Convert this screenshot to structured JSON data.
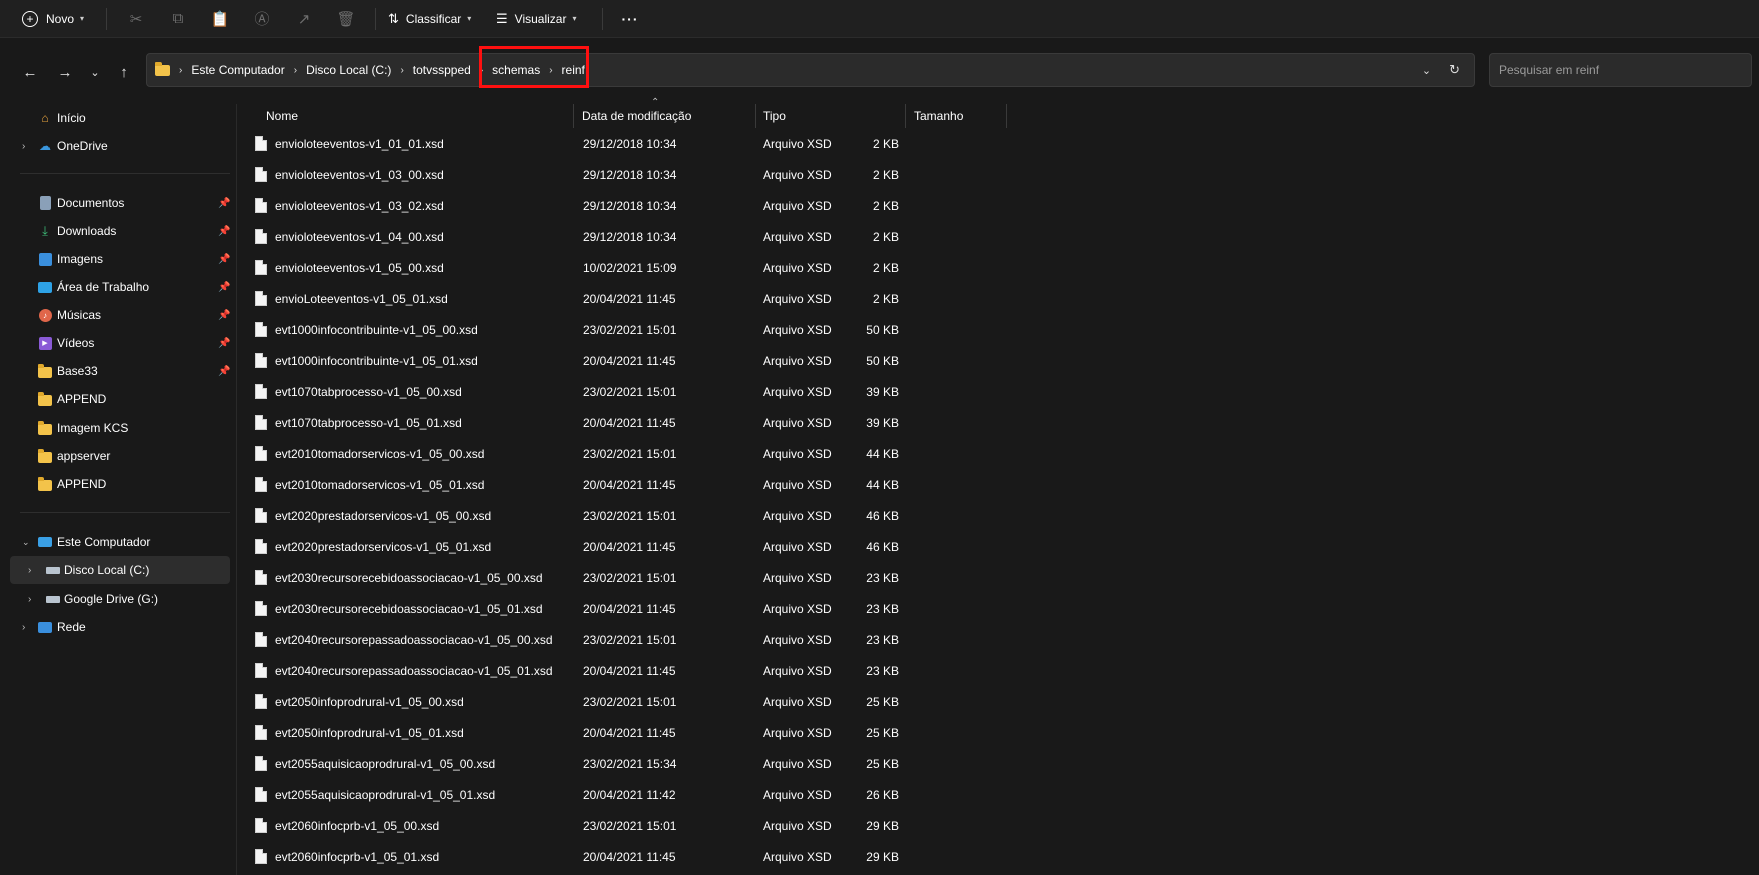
{
  "toolbar": {
    "new_label": "Novo",
    "sort_label": "Classificar",
    "view_label": "Visualizar",
    "more_label": "···"
  },
  "address": {
    "crumbs": [
      "Este Computador",
      "Disco Local (C:)",
      "totvsspped",
      "schemas",
      "reinf"
    ]
  },
  "search": {
    "placeholder": "Pesquisar em reinf"
  },
  "sidebar": {
    "top": [
      {
        "label": "Início"
      },
      {
        "label": "OneDrive"
      }
    ],
    "quick": [
      {
        "label": "Documentos"
      },
      {
        "label": "Downloads"
      },
      {
        "label": "Imagens"
      },
      {
        "label": "Área de Trabalho"
      },
      {
        "label": "Músicas"
      },
      {
        "label": "Vídeos"
      },
      {
        "label": "Base33"
      },
      {
        "label": "APPEND"
      },
      {
        "label": "Imagem KCS"
      },
      {
        "label": "appserver"
      },
      {
        "label": "APPEND"
      }
    ],
    "computer": [
      {
        "label": "Este Computador"
      },
      {
        "label": "Disco Local (C:)"
      },
      {
        "label": "Google Drive (G:)"
      },
      {
        "label": "Rede"
      }
    ]
  },
  "columns": {
    "name": "Nome",
    "modified": "Data de modificação",
    "type": "Tipo",
    "size": "Tamanho"
  },
  "files": [
    {
      "name": "envioloteeventos-v1_01_01.xsd",
      "modified": "29/12/2018 10:34",
      "type": "Arquivo XSD",
      "size": "2 KB"
    },
    {
      "name": "envioloteeventos-v1_03_00.xsd",
      "modified": "29/12/2018 10:34",
      "type": "Arquivo XSD",
      "size": "2 KB"
    },
    {
      "name": "envioloteeventos-v1_03_02.xsd",
      "modified": "29/12/2018 10:34",
      "type": "Arquivo XSD",
      "size": "2 KB"
    },
    {
      "name": "envioloteeventos-v1_04_00.xsd",
      "modified": "29/12/2018 10:34",
      "type": "Arquivo XSD",
      "size": "2 KB"
    },
    {
      "name": "envioloteeventos-v1_05_00.xsd",
      "modified": "10/02/2021 15:09",
      "type": "Arquivo XSD",
      "size": "2 KB"
    },
    {
      "name": "envioLoteeventos-v1_05_01.xsd",
      "modified": "20/04/2021 11:45",
      "type": "Arquivo XSD",
      "size": "2 KB"
    },
    {
      "name": "evt1000infocontribuinte-v1_05_00.xsd",
      "modified": "23/02/2021 15:01",
      "type": "Arquivo XSD",
      "size": "50 KB"
    },
    {
      "name": "evt1000infocontribuinte-v1_05_01.xsd",
      "modified": "20/04/2021 11:45",
      "type": "Arquivo XSD",
      "size": "50 KB"
    },
    {
      "name": "evt1070tabprocesso-v1_05_00.xsd",
      "modified": "23/02/2021 15:01",
      "type": "Arquivo XSD",
      "size": "39 KB"
    },
    {
      "name": "evt1070tabprocesso-v1_05_01.xsd",
      "modified": "20/04/2021 11:45",
      "type": "Arquivo XSD",
      "size": "39 KB"
    },
    {
      "name": "evt2010tomadorservicos-v1_05_00.xsd",
      "modified": "23/02/2021 15:01",
      "type": "Arquivo XSD",
      "size": "44 KB"
    },
    {
      "name": "evt2010tomadorservicos-v1_05_01.xsd",
      "modified": "20/04/2021 11:45",
      "type": "Arquivo XSD",
      "size": "44 KB"
    },
    {
      "name": "evt2020prestadorservicos-v1_05_00.xsd",
      "modified": "23/02/2021 15:01",
      "type": "Arquivo XSD",
      "size": "46 KB"
    },
    {
      "name": "evt2020prestadorservicos-v1_05_01.xsd",
      "modified": "20/04/2021 11:45",
      "type": "Arquivo XSD",
      "size": "46 KB"
    },
    {
      "name": "evt2030recursorecebidoassociacao-v1_05_00.xsd",
      "modified": "23/02/2021 15:01",
      "type": "Arquivo XSD",
      "size": "23 KB"
    },
    {
      "name": "evt2030recursorecebidoassociacao-v1_05_01.xsd",
      "modified": "20/04/2021 11:45",
      "type": "Arquivo XSD",
      "size": "23 KB"
    },
    {
      "name": "evt2040recursorepassadoassociacao-v1_05_00.xsd",
      "modified": "23/02/2021 15:01",
      "type": "Arquivo XSD",
      "size": "23 KB"
    },
    {
      "name": "evt2040recursorepassadoassociacao-v1_05_01.xsd",
      "modified": "20/04/2021 11:45",
      "type": "Arquivo XSD",
      "size": "23 KB"
    },
    {
      "name": "evt2050infoprodrural-v1_05_00.xsd",
      "modified": "23/02/2021 15:01",
      "type": "Arquivo XSD",
      "size": "25 KB"
    },
    {
      "name": "evt2050infoprodrural-v1_05_01.xsd",
      "modified": "20/04/2021 11:45",
      "type": "Arquivo XSD",
      "size": "25 KB"
    },
    {
      "name": "evt2055aquisicaoprodrural-v1_05_00.xsd",
      "modified": "23/02/2021 15:34",
      "type": "Arquivo XSD",
      "size": "25 KB"
    },
    {
      "name": "evt2055aquisicaoprodrural-v1_05_01.xsd",
      "modified": "20/04/2021 11:42",
      "type": "Arquivo XSD",
      "size": "26 KB"
    },
    {
      "name": "evt2060infocprb-v1_05_00.xsd",
      "modified": "23/02/2021 15:01",
      "type": "Arquivo XSD",
      "size": "29 KB"
    },
    {
      "name": "evt2060infocprb-v1_05_01.xsd",
      "modified": "20/04/2021 11:45",
      "type": "Arquivo XSD",
      "size": "29 KB"
    }
  ]
}
